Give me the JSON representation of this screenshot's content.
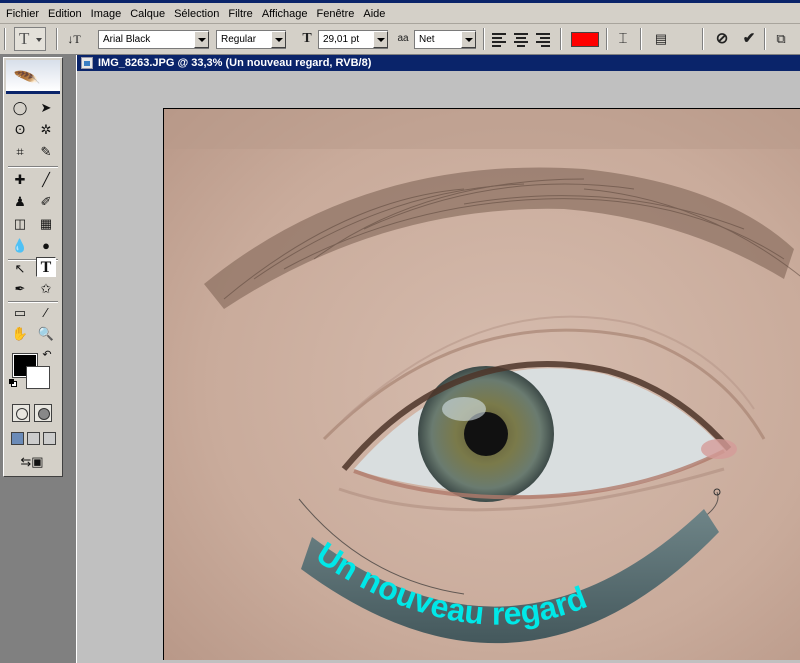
{
  "menu": {
    "items": [
      "Fichier",
      "Edition",
      "Image",
      "Calque",
      "Sélection",
      "Filtre",
      "Affichage",
      "Fenêtre",
      "Aide"
    ]
  },
  "options": {
    "font_family": "Arial Black",
    "font_style": "Regular",
    "font_size": "29,01 pt",
    "antialias_label": "aa",
    "antialias": "Net",
    "text_color": "#ff0000"
  },
  "document": {
    "title": "IMG_8263.JPG @ 33,3% (Un nouveau regard, RVB/8)",
    "warped_text": "Un nouveau regard",
    "text_fill": "#00e8e8"
  },
  "toolbox": {
    "foreground_color": "#000000",
    "background_color": "#ffffff"
  }
}
